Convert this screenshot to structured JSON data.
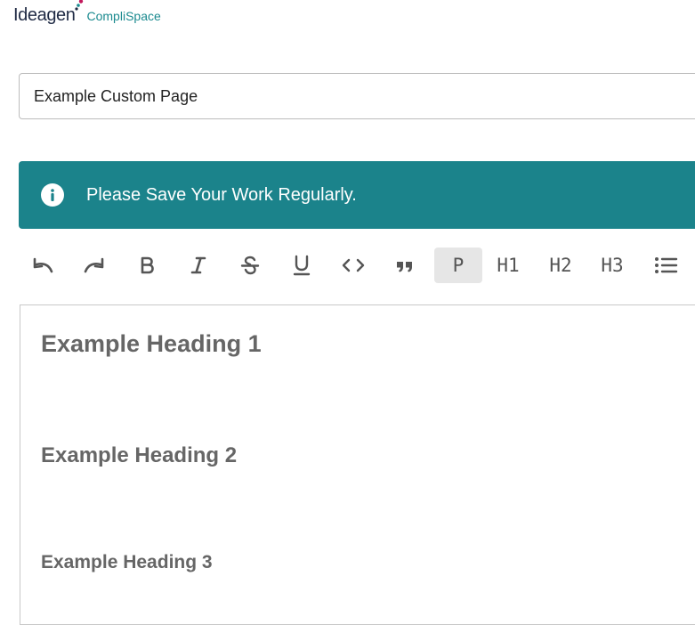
{
  "logo": {
    "brand": "Ideagen",
    "product": "CompliSpace"
  },
  "page_title_input": {
    "value": "Example Custom Page"
  },
  "banner": {
    "message": "Please Save Your Work Regularly.",
    "icon": "info-icon"
  },
  "toolbar": {
    "items": [
      {
        "icon": "undo-icon"
      },
      {
        "icon": "redo-icon"
      },
      {
        "icon": "bold-icon"
      },
      {
        "icon": "italic-icon"
      },
      {
        "icon": "strikethrough-icon"
      },
      {
        "icon": "underline-icon"
      },
      {
        "icon": "code-icon"
      },
      {
        "icon": "blockquote-icon"
      },
      {
        "label": "P",
        "active": true
      },
      {
        "label": "H1"
      },
      {
        "label": "H2"
      },
      {
        "label": "H3"
      },
      {
        "icon": "bullet-list-icon"
      }
    ]
  },
  "editor": {
    "heading1": "Example Heading 1",
    "heading2": "Example Heading 2",
    "heading3": "Example Heading 3"
  },
  "colors": {
    "banner": "#1b838b",
    "brand_accent": "#1b8a8f",
    "active_button": "#e6e6e6"
  }
}
